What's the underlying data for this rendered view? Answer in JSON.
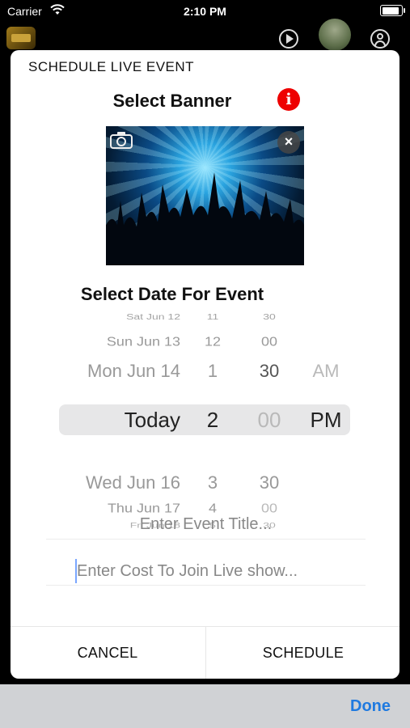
{
  "status_bar": {
    "carrier": "Carrier",
    "time": "2:10 PM"
  },
  "modal": {
    "title": "SCHEDULE LIVE EVENT",
    "banner_section": {
      "title": "Select Banner",
      "info_glyph": "i"
    },
    "date_section": {
      "title": "Select Date For Event"
    },
    "picker": {
      "rows": [
        {
          "date": "Sat Jun 12",
          "hour": "11",
          "minute": "30",
          "ampm": ""
        },
        {
          "date": "Sun Jun 13",
          "hour": "12",
          "minute": "00",
          "ampm": ""
        },
        {
          "date": "Mon Jun 14",
          "hour": "1",
          "minute": "30",
          "ampm": "AM"
        },
        {
          "date": "Today",
          "hour": "2",
          "minute": "00",
          "ampm": "PM"
        },
        {
          "date": "Wed Jun 16",
          "hour": "3",
          "minute": "30",
          "ampm": ""
        },
        {
          "date": "Thu Jun 17",
          "hour": "4",
          "minute": "00",
          "ampm": ""
        },
        {
          "date": "Fri Jun 18",
          "hour": "5",
          "minute": "30",
          "ampm": ""
        }
      ],
      "selected_index": 3
    },
    "event_title_placeholder": "Enter Event Title...",
    "cost_placeholder": "Enter Cost To Join Live show...",
    "cancel_label": "CANCEL",
    "schedule_label": "SCHEDULE"
  },
  "keyboard_toolbar": {
    "done_label": "Done"
  },
  "colors": {
    "accent": "#1f7ae0",
    "info": "#e00000"
  },
  "icons": [
    "wifi-icon",
    "battery-icon",
    "play-icon",
    "profile-icon",
    "info-icon",
    "camera-icon",
    "close-icon"
  ]
}
